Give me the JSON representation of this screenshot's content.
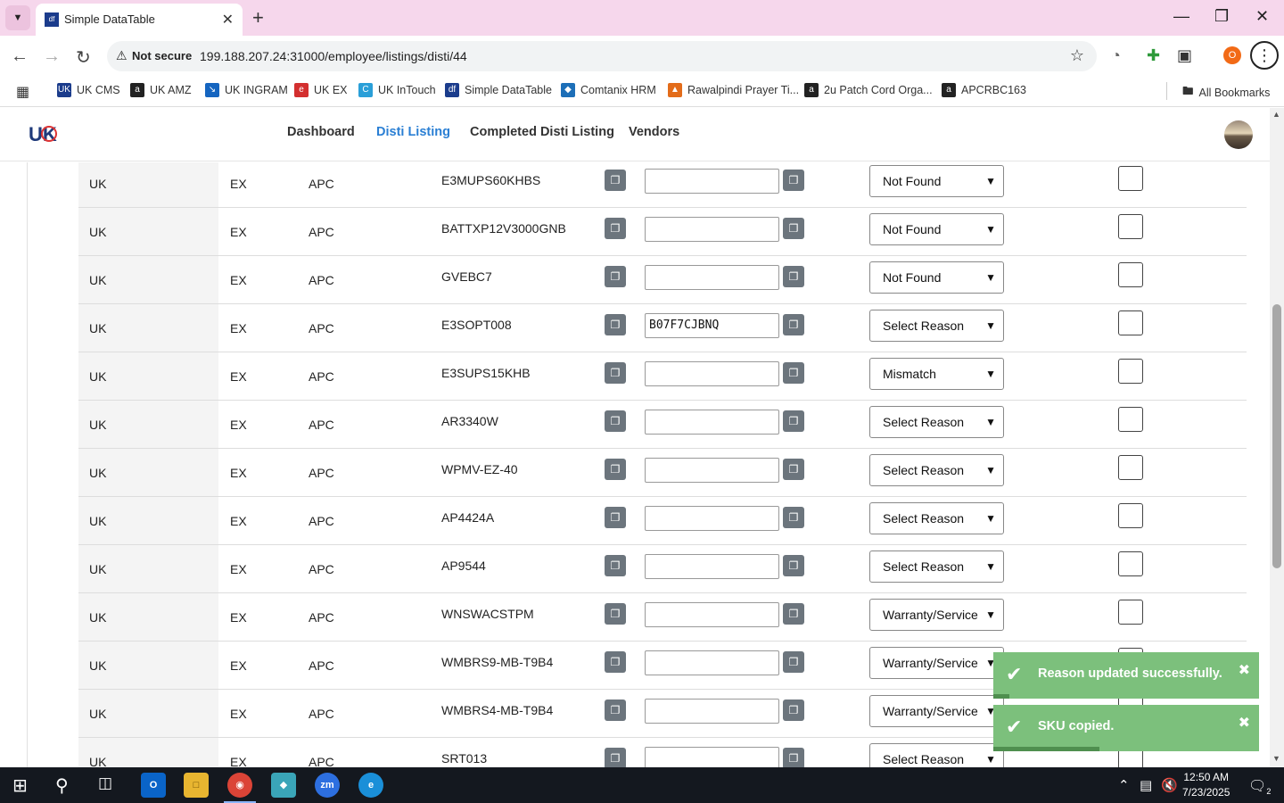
{
  "browser": {
    "tab_title": "Simple DataTable",
    "tab_favicon": "df",
    "security_label": "Not secure",
    "url": "199.188.207.24:31000/employee/listings/disti/44",
    "bookmarks": [
      {
        "label": "UK CMS",
        "icon": "UK",
        "color": "#1b3c8c"
      },
      {
        "label": "UK AMZ",
        "icon": "a",
        "color": "#222222"
      },
      {
        "label": "UK INGRAM",
        "icon": "↘",
        "color": "#1565c0"
      },
      {
        "label": "UK EX",
        "icon": "e",
        "color": "#d32f2f"
      },
      {
        "label": "UK InTouch",
        "icon": "C",
        "color": "#2a9fd8"
      },
      {
        "label": "Simple DataTable",
        "icon": "df",
        "color": "#1b3c8c"
      },
      {
        "label": "Comtanix HRM",
        "icon": "◆",
        "color": "#1d6fb8"
      },
      {
        "label": "Rawalpindi Prayer Ti...",
        "icon": "▲",
        "color": "#e36c1a"
      },
      {
        "label": "2u Patch Cord Orga...",
        "icon": "a",
        "color": "#222222"
      },
      {
        "label": "APCRBC163",
        "icon": "a",
        "color": "#222222"
      }
    ],
    "all_bookmarks": "All Bookmarks",
    "profile_initial": "O"
  },
  "nav": {
    "logo": "UK",
    "links": [
      "Dashboard",
      "Disti Listing",
      "Completed Disti Listing",
      "Vendors"
    ]
  },
  "rows": [
    {
      "region": "UK",
      "type": "EX",
      "brand": "APC",
      "sku": "E3MUPS60KHBS",
      "asin": "",
      "reason": "Not Found"
    },
    {
      "region": "UK",
      "type": "EX",
      "brand": "APC",
      "sku": "BATTXP12V3000GNB",
      "asin": "",
      "reason": "Not Found"
    },
    {
      "region": "UK",
      "type": "EX",
      "brand": "APC",
      "sku": "GVEBC7",
      "asin": "",
      "reason": "Not Found"
    },
    {
      "region": "UK",
      "type": "EX",
      "brand": "APC",
      "sku": "E3SOPT008",
      "asin": "B07F7CJBNQ",
      "reason": "Select Reason"
    },
    {
      "region": "UK",
      "type": "EX",
      "brand": "APC",
      "sku": "E3SUPS15KHB",
      "asin": "",
      "reason": "Mismatch"
    },
    {
      "region": "UK",
      "type": "EX",
      "brand": "APC",
      "sku": "AR3340W",
      "asin": "",
      "reason": "Select Reason"
    },
    {
      "region": "UK",
      "type": "EX",
      "brand": "APC",
      "sku": "WPMV-EZ-40",
      "asin": "",
      "reason": "Select Reason"
    },
    {
      "region": "UK",
      "type": "EX",
      "brand": "APC",
      "sku": "AP4424A",
      "asin": "",
      "reason": "Select Reason"
    },
    {
      "region": "UK",
      "type": "EX",
      "brand": "APC",
      "sku": "AP9544",
      "asin": "",
      "reason": "Select Reason"
    },
    {
      "region": "UK",
      "type": "EX",
      "brand": "APC",
      "sku": "WNSWACSTPM",
      "asin": "",
      "reason": "Warranty/Service"
    },
    {
      "region": "UK",
      "type": "EX",
      "brand": "APC",
      "sku": "WMBRS9-MB-T9B4",
      "asin": "",
      "reason": "Warranty/Service"
    },
    {
      "region": "UK",
      "type": "EX",
      "brand": "APC",
      "sku": "WMBRS4-MB-T9B4",
      "asin": "",
      "reason": "Warranty/Service"
    },
    {
      "region": "UK",
      "type": "EX",
      "brand": "APC",
      "sku": "SRT013",
      "asin": "",
      "reason": "Select Reason"
    }
  ],
  "toasts": [
    {
      "message": "Reason updated successfully.",
      "progress": 0.06
    },
    {
      "message": "SKU copied.",
      "progress": 0.4
    }
  ],
  "taskbar": {
    "time": "12:50 AM",
    "date": "7/23/2025",
    "notification_count": "2"
  }
}
